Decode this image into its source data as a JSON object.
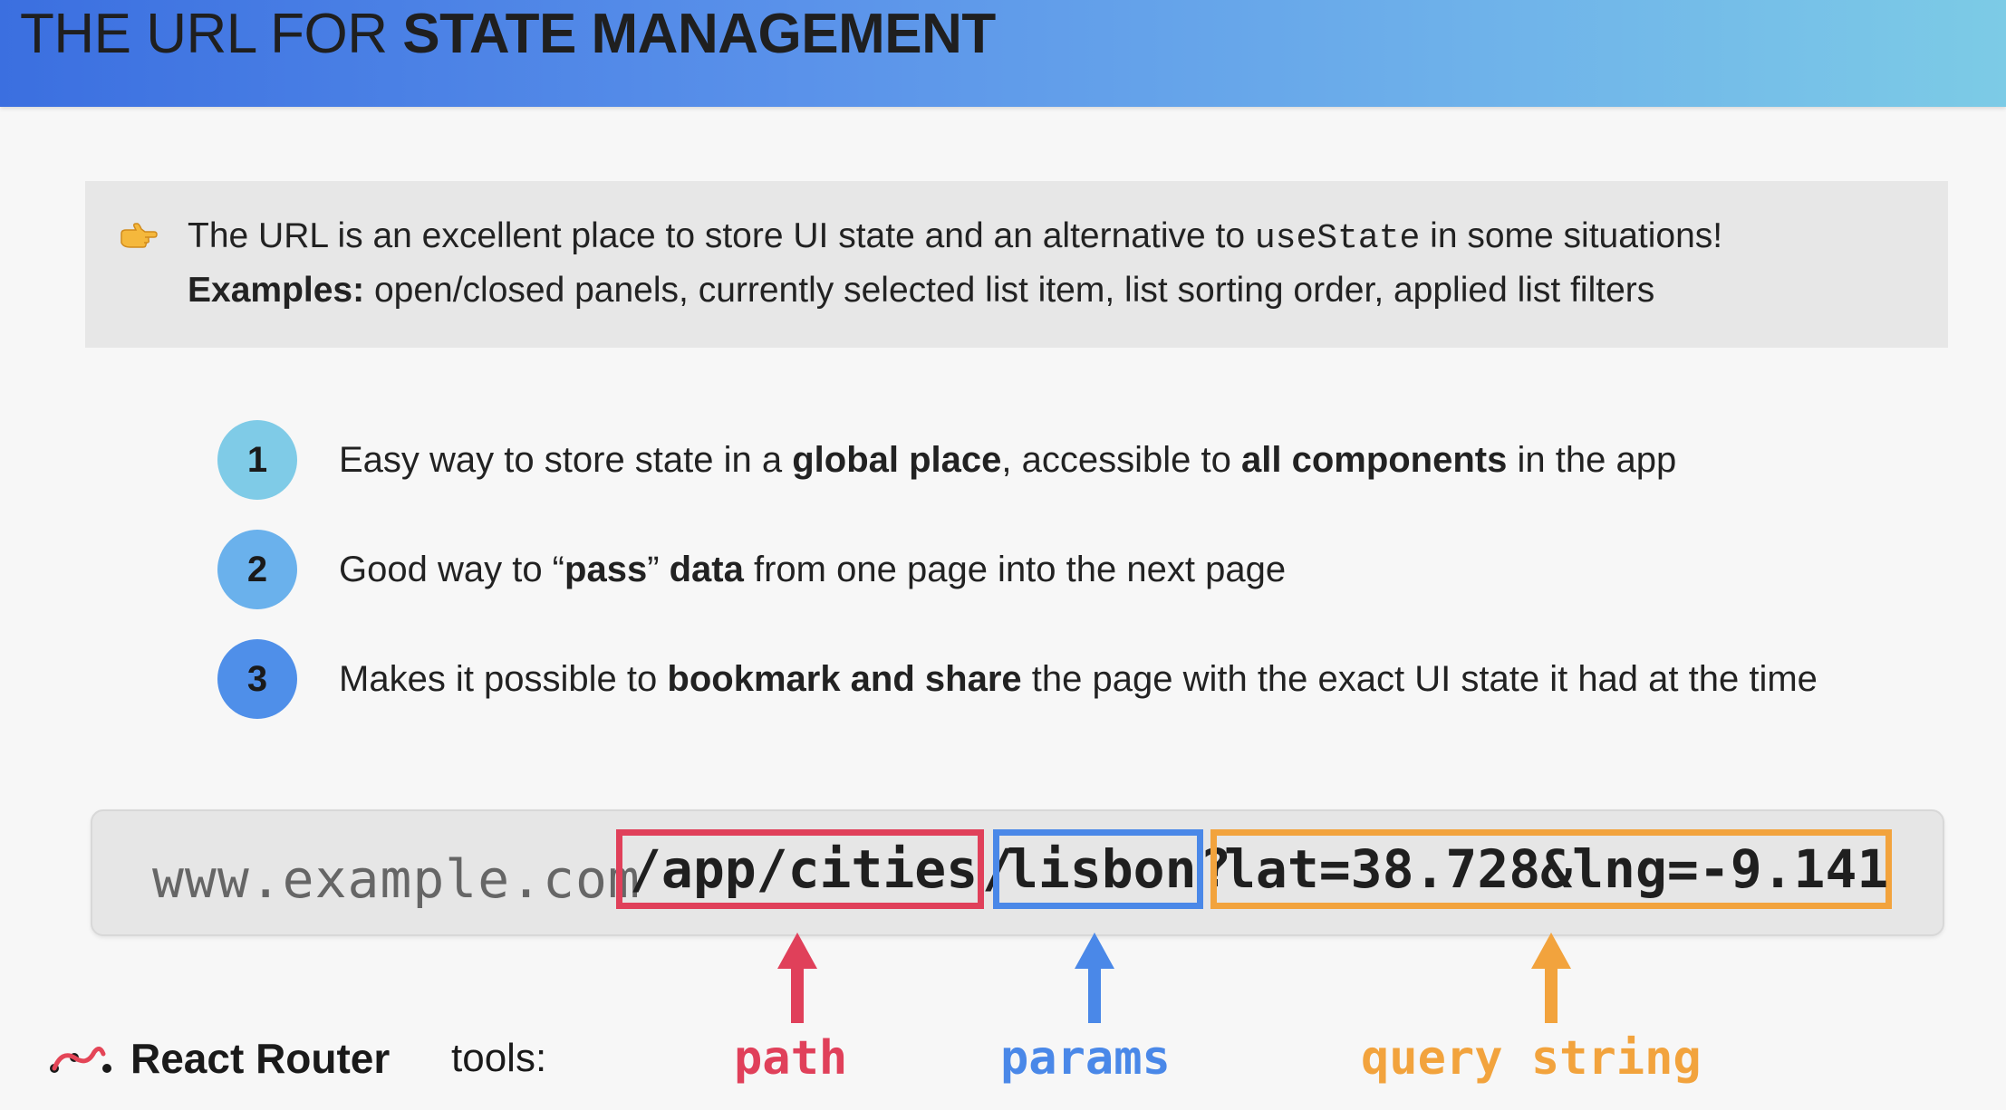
{
  "header": {
    "title_regular": "THE URL FOR ",
    "title_bold": "STATE MANAGEMENT"
  },
  "callout": {
    "icon": "pointing-hand-icon",
    "line1_text": "The URL is an excellent place to store UI state and an alternative to ",
    "line1_code": "useState",
    "line1_end": " in some situations!",
    "line2_bold": "Examples:",
    "line2_text": " open/closed panels, currently selected list item, list sorting order, applied list filters"
  },
  "points": [
    {
      "number": "1",
      "color": "#7fcbe7",
      "parts": [
        "Easy way to store state in a ",
        "global place",
        ", accessible to ",
        "all components",
        " in the app"
      ]
    },
    {
      "number": "2",
      "color": "#6ab1ec",
      "parts": [
        "Good way to “",
        "pass",
        "” ",
        "data",
        " from one page into the next page"
      ]
    },
    {
      "number": "3",
      "color": "#4f8fe9",
      "parts": [
        "Makes it possible to ",
        "bookmark and share",
        " the page with the exact UI state it had at the time"
      ]
    }
  ],
  "url": {
    "host": "www.example.com",
    "path": "/app/cities",
    "sep1": "/",
    "params": "lisbon",
    "sep2": "?",
    "query": "lat=38.728&lng=-9.141"
  },
  "labels": {
    "path": "path",
    "params": "params",
    "query": "query string"
  },
  "colors": {
    "path": "#e0405a",
    "params": "#4a88e8",
    "query": "#f2a33d",
    "logo_red": "#e44557"
  },
  "footer": {
    "brand": "React Router",
    "tools": "tools:"
  }
}
